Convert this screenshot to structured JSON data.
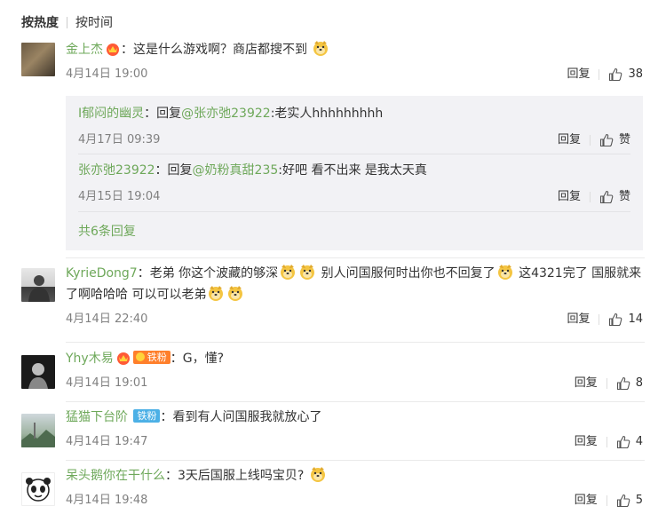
{
  "sort_tabs": {
    "hot": "按热度",
    "time": "按时间"
  },
  "actions": {
    "reply": "回复",
    "like": "赞"
  },
  "comments": [
    {
      "user": "金上杰",
      "text": "这是什么游戏啊？商店都搜不到",
      "time": "4月14日 19:00",
      "likes": "38",
      "replies": [
        {
          "user": "I郁闷的幽灵",
          "prefix": "回复",
          "mention": "@张亦弛23922",
          "text": ":老实人hhhhhhhhh",
          "time": "4月17日 09:39"
        },
        {
          "user": "张亦弛23922",
          "prefix": "回复",
          "mention": "@奶粉真甜235",
          "text": ":好吧 看不出来 是我太天真",
          "time": "4月15日 19:04"
        }
      ],
      "more_replies": "共6条回复"
    },
    {
      "user": "KyrieDong7",
      "text_parts": [
        "老弟 你这个波藏的够深",
        " 别人问国服何时出你也不回复了",
        " 这4321完了 国服就来了啊哈哈哈 可以可以老弟"
      ],
      "time": "4月14日 22:40",
      "likes": "14"
    },
    {
      "user": "Yhy木易",
      "badge": "铁粉",
      "text": "G，懂?",
      "time": "4月14日 19:01",
      "likes": "8"
    },
    {
      "user": "猛猫下台阶",
      "badge": "铁粉",
      "text": "看到有人问国服我就放心了",
      "time": "4月14日 19:47",
      "likes": "4"
    },
    {
      "user": "呆头鹅你在干什么",
      "text": "3天后国服上线吗宝贝?",
      "time": "4月14日 19:48",
      "likes": "5"
    }
  ],
  "colors": {
    "username": "#6ea85a",
    "badge_iron": "#4cb0e6",
    "reply_bg": "#f2f2f5"
  }
}
